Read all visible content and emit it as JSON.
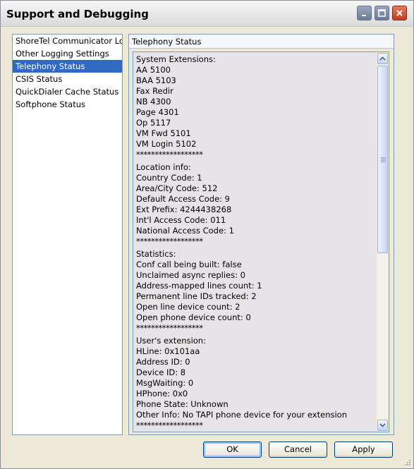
{
  "window": {
    "title": "Support and Debugging"
  },
  "sidebar": {
    "items": [
      {
        "label": "ShoreTel Communicator Log"
      },
      {
        "label": "Other Logging Settings"
      },
      {
        "label": "Telephony Status",
        "selected": true
      },
      {
        "label": "CSIS Status"
      },
      {
        "label": "QuickDialer Cache Status"
      },
      {
        "label": "Softphone Status"
      }
    ]
  },
  "panel": {
    "header": "Telephony Status",
    "lines": [
      "System Extensions:",
      "AA 5100",
      "BAA 5103",
      "Fax Redir",
      "NB 4300",
      "Page 4301",
      "Op 5117",
      "VM Fwd 5101",
      "VM Login 5102",
      "******************",
      "",
      "Location info:",
      "Country Code: 1",
      "Area/City Code: 512",
      "Default Access Code: 9",
      "Ext Prefix: 4244438268",
      "Int'l Access Code: 011",
      "National Access Code: 1",
      "******************",
      "",
      "Statistics:",
      "Conf call being built: false",
      "Unclaimed async replies: 0",
      "Address-mapped lines count: 1",
      "Permanent line IDs tracked: 2",
      "Open line device count: 2",
      "Open phone device count: 0",
      "******************",
      "",
      "User's extension:",
      "HLine: 0x101aa",
      "Address ID: 0",
      "Device ID: 8",
      "MsgWaiting: 0",
      "HPhone: 0x0",
      "Phone State: Unknown",
      "Other Info: No TAPI phone device for your extension",
      "******************"
    ]
  },
  "buttons": {
    "ok": "OK",
    "cancel": "Cancel",
    "apply": "Apply"
  }
}
